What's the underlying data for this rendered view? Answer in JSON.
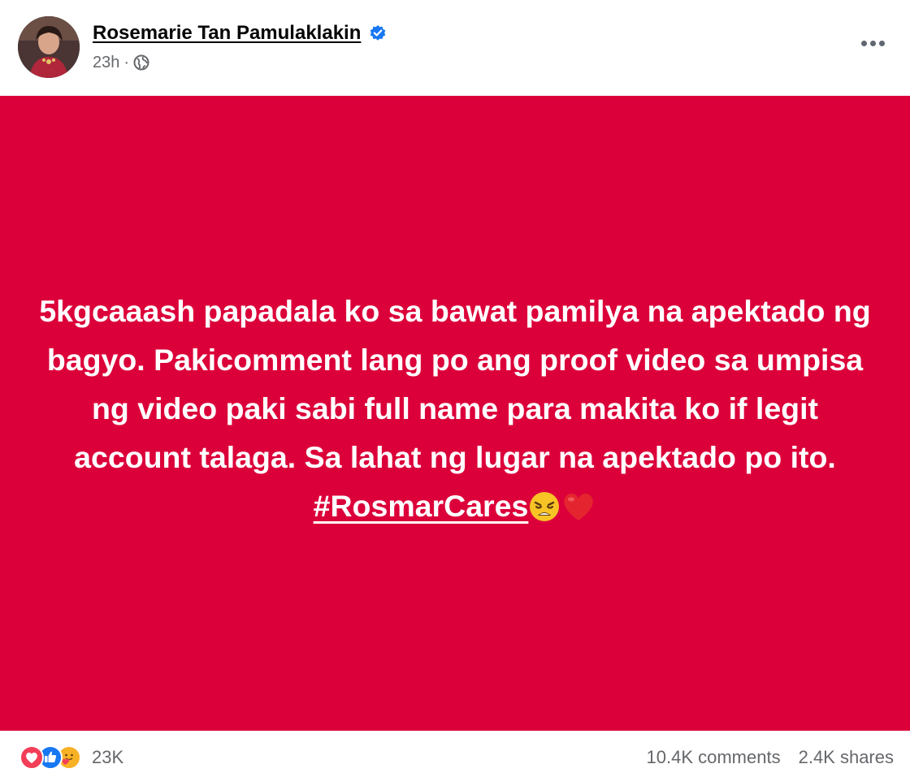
{
  "post": {
    "author": "Rosemarie Tan Pamulaklakin",
    "time": "23h",
    "separator": "·",
    "text_main": "5kgcaaash papadala ko sa bawat pamilya na apektado ng bagyo. Pakicomment lang po ang proof video sa umpisa ng video paki sabi full name para makita ko if legit account talaga. Sa lahat ng lugar na apektado po ito.",
    "hashtag": "#RosmarCares",
    "background_color": "#dc003a",
    "emojis": [
      "weary-face-emoji",
      "red-heart-emoji"
    ]
  },
  "footer": {
    "reaction_icons": [
      "love-icon",
      "like-icon",
      "care-icon"
    ],
    "reaction_count": "23K",
    "comments": "10.4K comments",
    "shares": "2.4K shares"
  },
  "colors": {
    "verified_blue": "#1877f2",
    "like_blue": "#1877f2",
    "love_red": "#f33e58",
    "care_yellow": "#f7b125",
    "secondary_text": "#65676b"
  }
}
